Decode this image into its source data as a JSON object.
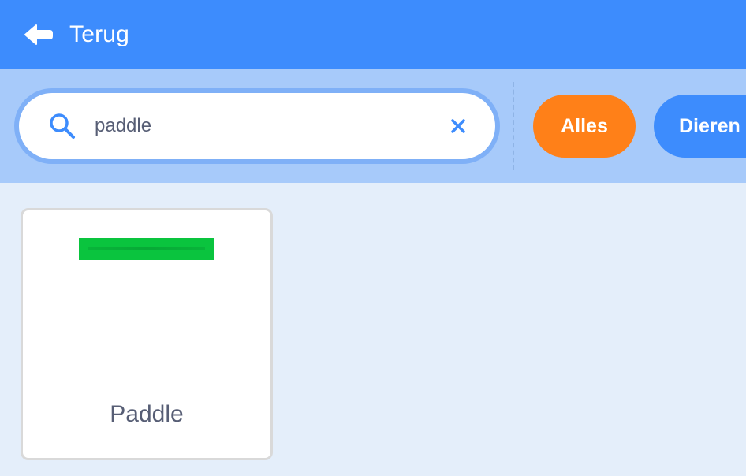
{
  "header": {
    "back_label": "Terug",
    "back_icon": "arrow-left-icon",
    "background_color": "#3d8cfd"
  },
  "search": {
    "value": "paddle",
    "icon": "search-icon",
    "clear_icon": "close-icon"
  },
  "tags": [
    {
      "label": "Alles",
      "selected": true,
      "color": "#ff8018"
    },
    {
      "label": "Dieren",
      "selected": false,
      "color": "#3d8cfd"
    }
  ],
  "results": [
    {
      "name": "Paddle",
      "thumbnail_color": "#0ac43e"
    }
  ]
}
